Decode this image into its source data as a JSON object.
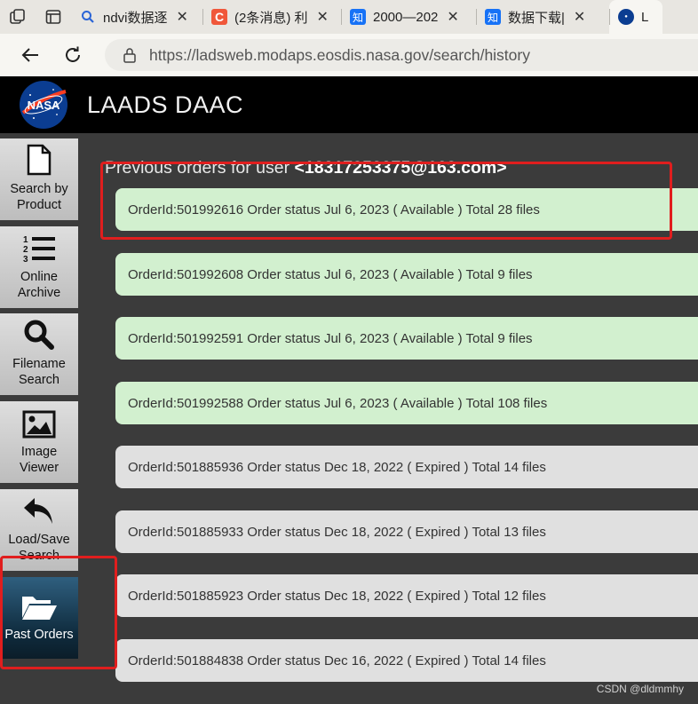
{
  "browser": {
    "tabs": [
      {
        "title": "ndvi数据逐",
        "favicon": "search-icon",
        "fav_color": "#2a64d6"
      },
      {
        "title": "(2条消息) 利",
        "favicon": "csdn-icon",
        "fav_color": "#f0573a"
      },
      {
        "title": "2000—202",
        "favicon": "zhihu-icon",
        "fav_color": "#1772f6",
        "fav_text": "知"
      },
      {
        "title": "数据下载|",
        "favicon": "zhihu-icon",
        "fav_color": "#1772f6",
        "fav_text": "知"
      },
      {
        "title": "L",
        "favicon": "nasa-icon",
        "fav_color": "#0b3d91"
      }
    ],
    "url": "https://ladsweb.modaps.eosdis.nasa.gov/search/history"
  },
  "site": {
    "logo_text": "NASA",
    "title": "LAADS DAAC"
  },
  "sidebar": {
    "items": [
      {
        "line1": "Search by",
        "line2": "Product",
        "icon": "document-icon"
      },
      {
        "line1": "Online",
        "line2": "Archive",
        "icon": "numbered-list-icon"
      },
      {
        "line1": "Filename",
        "line2": "Search",
        "icon": "magnifier-icon"
      },
      {
        "line1": "Image",
        "line2": "Viewer",
        "icon": "image-icon"
      },
      {
        "line1": "Load/Save",
        "line2": "Search",
        "icon": "undo-arrow-icon"
      },
      {
        "line1": "Past Orders",
        "line2": "",
        "icon": "folder-open-icon",
        "active": true
      }
    ]
  },
  "main": {
    "heading_prefix": "Previous orders for user ",
    "user": "<18317253375@163.com>",
    "orders": [
      {
        "text": "OrderId:501992616 Order status Jul 6, 2023 ( Available ) Total 28 files",
        "status": "Available"
      },
      {
        "text": "OrderId:501992608 Order status Jul 6, 2023 ( Available ) Total 9 files",
        "status": "Available"
      },
      {
        "text": "OrderId:501992591 Order status Jul 6, 2023 ( Available ) Total 9 files",
        "status": "Available"
      },
      {
        "text": "OrderId:501992588 Order status Jul 6, 2023 ( Available ) Total 108 files",
        "status": "Available"
      },
      {
        "text": "OrderId:501885936 Order status Dec 18, 2022 ( Expired ) Total 14 files",
        "status": "Expired"
      },
      {
        "text": "OrderId:501885933 Order status Dec 18, 2022 ( Expired ) Total 13 files",
        "status": "Expired"
      },
      {
        "text": "OrderId:501885923 Order status Dec 18, 2022 ( Expired ) Total 12 files",
        "status": "Expired"
      },
      {
        "text": "OrderId:501884838 Order status Dec 16, 2022 ( Expired ) Total 14 files",
        "status": "Expired"
      }
    ]
  },
  "watermark": "CSDN @dldmmhy",
  "colors": {
    "available": "#d2f0cf",
    "expired": "#e0e0e0",
    "annotation": "#e01e1e",
    "header": "#000000",
    "background": "#3b3b3b"
  }
}
